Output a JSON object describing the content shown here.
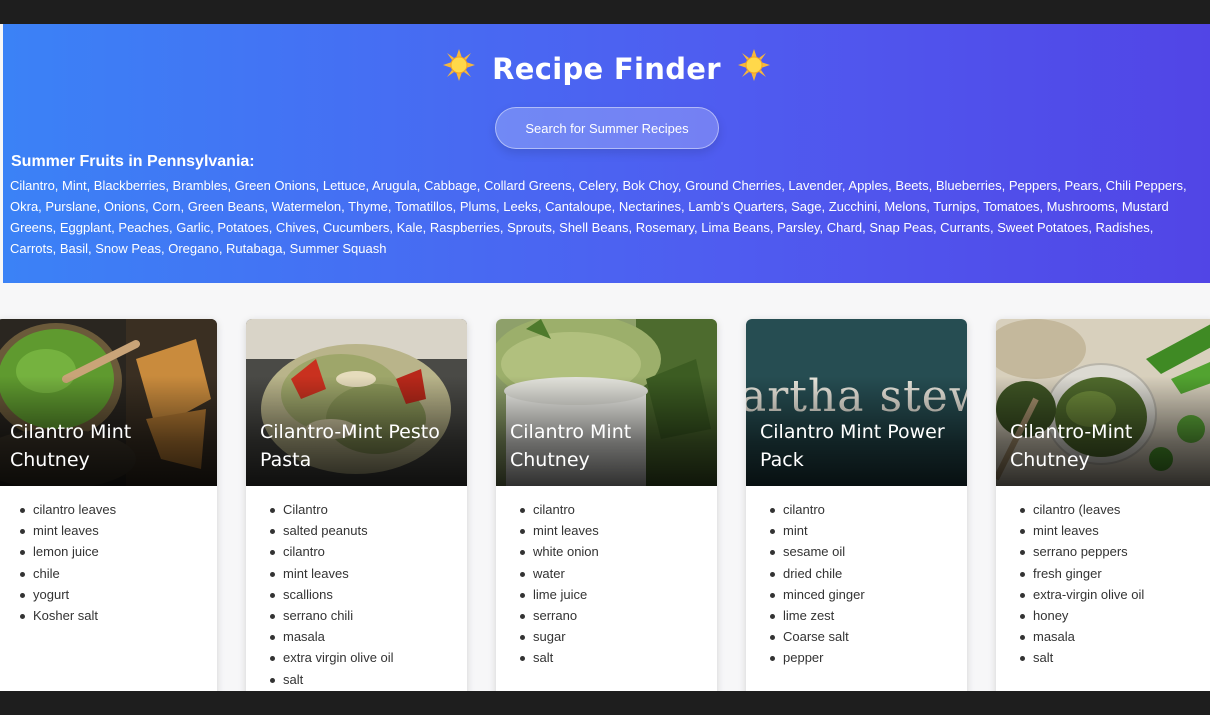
{
  "header": {
    "title": "Recipe Finder",
    "icon": "sun-icon",
    "search_button_label": "Search for Summer Recipes"
  },
  "fruits": {
    "heading": "Summer Fruits in Pennsylvania:",
    "list": "Cilantro, Mint, Blackberries, Brambles, Green Onions, Lettuce, Arugula, Cabbage, Collard Greens, Celery, Bok Choy, Ground Cherries, Lavender, Apples, Beets, Blueberries, Peppers, Pears, Chili Peppers, Okra, Purslane, Onions, Corn, Green Beans, Watermelon, Thyme, Tomatillos, Plums, Leeks, Cantaloupe, Nectarines, Lamb's Quarters, Sage, Zucchini, Melons, Turnips, Tomatoes, Mushrooms, Mustard Greens, Eggplant, Peaches, Garlic, Potatoes, Chives, Cucumbers, Kale, Raspberries, Sprouts, Shell Beans, Rosemary, Lima Beans, Parsley, Chard, Snap Peas, Currants, Sweet Potatoes, Radishes, Carrots, Basil, Snow Peas, Oregano, Rutabaga, Summer Squash"
  },
  "recipes": [
    {
      "title": "Cilantro Mint Chutney",
      "image": "chutney-bowl-photo",
      "ingredients": [
        "cilantro leaves",
        "mint leaves",
        "lemon juice",
        "chile",
        "yogurt",
        "Kosher salt"
      ]
    },
    {
      "title": "Cilantro-Mint Pesto Pasta",
      "image": "pesto-pasta-photo",
      "ingredients": [
        "Cilantro",
        "salted peanuts",
        "cilantro",
        "mint leaves",
        "scallions",
        "serrano chili",
        "masala",
        "extra virgin olive oil",
        "salt"
      ]
    },
    {
      "title": "Cilantro Mint Chutney",
      "image": "chutney-white-bowl-photo",
      "ingredients": [
        "cilantro",
        "mint leaves",
        "white onion",
        "water",
        "lime juice",
        "serrano",
        "sugar",
        "salt"
      ]
    },
    {
      "title": "Cilantro Mint Power Pack",
      "image": "martha-stewart-logo-image",
      "image_text": "artha stewa",
      "ingredients": [
        "cilantro",
        "mint",
        "sesame oil",
        "dried chile",
        "minced ginger",
        "lime zest",
        "Coarse salt",
        "pepper"
      ]
    },
    {
      "title": "Cilantro-Mint Chutney",
      "image": "chutney-jar-photo",
      "ingredients": [
        "cilantro (leaves",
        "mint leaves",
        "serrano peppers",
        "fresh ginger",
        "extra-virgin olive oil",
        "honey",
        "masala",
        "salt"
      ]
    }
  ]
}
